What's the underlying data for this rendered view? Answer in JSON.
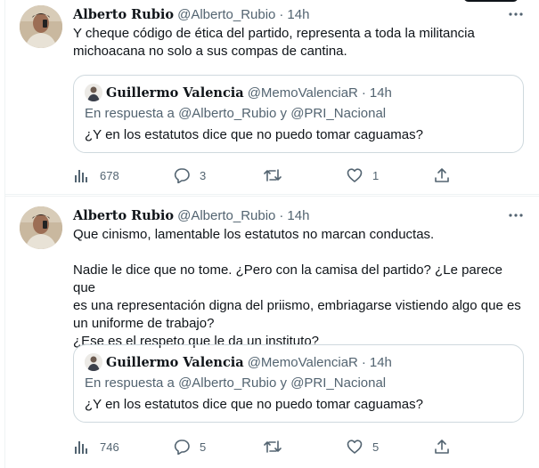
{
  "tweets": [
    {
      "author_name": "Alberto Rubio",
      "author_handle": "@Alberto_Rubio",
      "separator": "·",
      "time": "14h",
      "text": "Y cheque código de ética del partido, representa a toda la militancia\nmichoacana no solo a sus compas de cantina.",
      "quote": {
        "author_name": "Guillermo Valencia",
        "author_handle": "@MemoValenciaR",
        "separator": "·",
        "time": "14h",
        "reply_to": "En respuesta a @Alberto_Rubio y @PRI_Nacional",
        "text": "¿Y en los estatutos dice que no puedo tomar caguamas?"
      },
      "stats": {
        "views": "678",
        "replies": "3",
        "retweets": "",
        "likes": "1"
      }
    },
    {
      "author_name": "Alberto Rubio",
      "author_handle": "@Alberto_Rubio",
      "separator": "·",
      "time": "14h",
      "text_p1": "Que cinismo, lamentable los estatutos no marcan conductas.",
      "text_p2": "Nadie le dice que no tome. ¿Pero con la camisa del partido? ¿Le parece que\nes una representación digna del priismo, embriagarse vistiendo algo que es\nun uniforme de trabajo?\n¿Ese es el respeto que le da un instituto?",
      "quote": {
        "author_name": "Guillermo Valencia",
        "author_handle": "@MemoValenciaR",
        "separator": "·",
        "time": "14h",
        "reply_to": "En respuesta a @Alberto_Rubio y @PRI_Nacional",
        "text": "¿Y en los estatutos dice que no puedo tomar caguamas?"
      },
      "stats": {
        "views": "746",
        "replies": "5",
        "retweets": "",
        "likes": "5"
      }
    }
  ],
  "icons": {
    "views": "bar-chart-icon",
    "reply": "speech-bubble-icon",
    "retweet": "retweet-icon",
    "like": "heart-icon",
    "share": "share-icon",
    "more": "more-icon"
  },
  "colors": {
    "text_primary": "#0f1419",
    "text_secondary": "#536471",
    "border": "#cfd9de",
    "divider": "#eff3f4"
  }
}
